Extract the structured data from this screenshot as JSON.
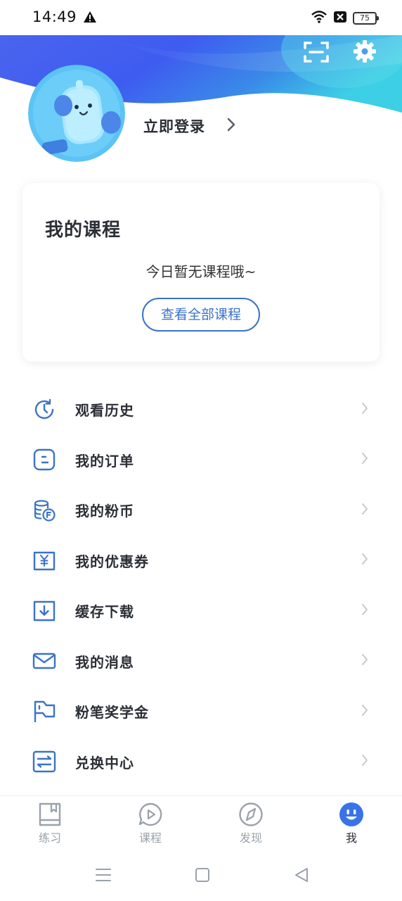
{
  "status_bar": {
    "time": "14:49",
    "battery": "75"
  },
  "profile": {
    "login_label": "立即登录"
  },
  "course_card": {
    "title": "我的课程",
    "empty_text": "今日暂无课程哦~",
    "view_all_label": "查看全部课程"
  },
  "menu": {
    "items": [
      {
        "label": "观看历史",
        "icon": "history-clock-icon"
      },
      {
        "label": "我的订单",
        "icon": "order-icon"
      },
      {
        "label": "我的粉币",
        "icon": "coin-icon"
      },
      {
        "label": "我的优惠券",
        "icon": "coupon-icon"
      },
      {
        "label": "缓存下载",
        "icon": "download-icon"
      },
      {
        "label": "我的消息",
        "icon": "mail-icon"
      },
      {
        "label": "粉笔奖学金",
        "icon": "flag-icon"
      },
      {
        "label": "兑换中心",
        "icon": "exchange-icon"
      }
    ]
  },
  "tabs": [
    {
      "label": "练习",
      "icon": "book-icon"
    },
    {
      "label": "课程",
      "icon": "play-bubble-icon"
    },
    {
      "label": "发现",
      "icon": "compass-icon"
    },
    {
      "label": "我",
      "icon": "smiley-icon",
      "active": true
    }
  ],
  "colors": {
    "accent": "#3a73c9",
    "header_gradient_start": "#3e5cf0",
    "header_gradient_end": "#3ccfe6",
    "text_primary": "#2b2f36",
    "tab_inactive": "#9aa1ab"
  }
}
